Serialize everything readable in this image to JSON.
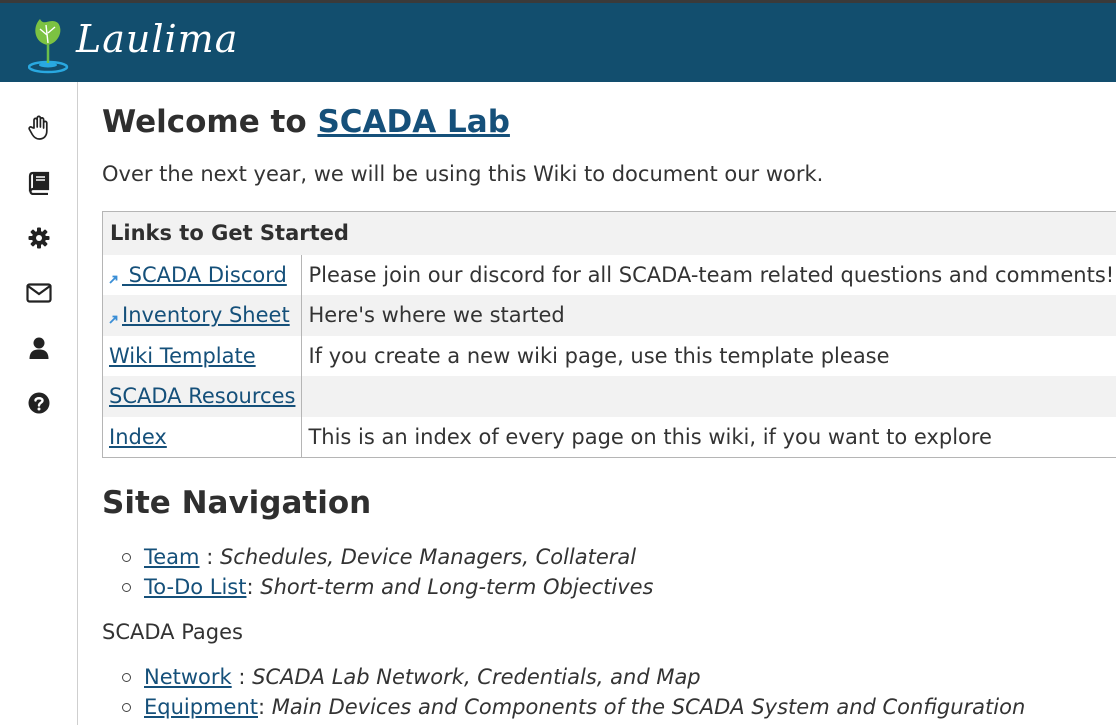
{
  "header": {
    "logo_text": "Laulima",
    "colors": {
      "bar": "#124e6e",
      "link": "#15507a"
    }
  },
  "sidebar": {
    "items": [
      {
        "icon": "hand-icon"
      },
      {
        "icon": "book-icon"
      },
      {
        "icon": "gear-icon"
      },
      {
        "icon": "envelope-icon"
      },
      {
        "icon": "user-icon"
      },
      {
        "icon": "help-icon"
      }
    ]
  },
  "main": {
    "welcome_prefix": "Welcome to",
    "welcome_link": "SCADA Lab",
    "intro": "Over the next year, we will be using this Wiki to document our work.",
    "table": {
      "header": "Links to Get Started",
      "rows": [
        {
          "link": " SCADA Discord",
          "desc": "Please join our discord for all SCADA-team related questions and comments!",
          "external": true
        },
        {
          "link": "Inventory Sheet",
          "desc": "Here's where we started",
          "external": true
        },
        {
          "link": "Wiki Template",
          "desc": "If you create a new wiki page, use this template please",
          "external": false
        },
        {
          "link": "SCADA Resources",
          "desc": "",
          "external": false
        },
        {
          "link": "Index",
          "desc": "This is an index of every page on this wiki, if you want to explore",
          "external": false
        }
      ]
    },
    "site_nav_title": "Site Navigation",
    "nav_items": [
      {
        "link": "Team",
        "sep": " : ",
        "desc": "Schedules, Device Managers, Collateral"
      },
      {
        "link": "To-Do List",
        "sep": ": ",
        "desc": "Short-term and Long-term Objectives"
      }
    ],
    "scada_pages_label": "SCADA Pages",
    "scada_items": [
      {
        "link": "Network",
        "sep": " : ",
        "desc": "SCADA Lab Network, Credentials, and Map"
      },
      {
        "link": "Equipment",
        "sep": ": ",
        "desc": "Main Devices and Components of the SCADA System and Configuration"
      }
    ]
  }
}
